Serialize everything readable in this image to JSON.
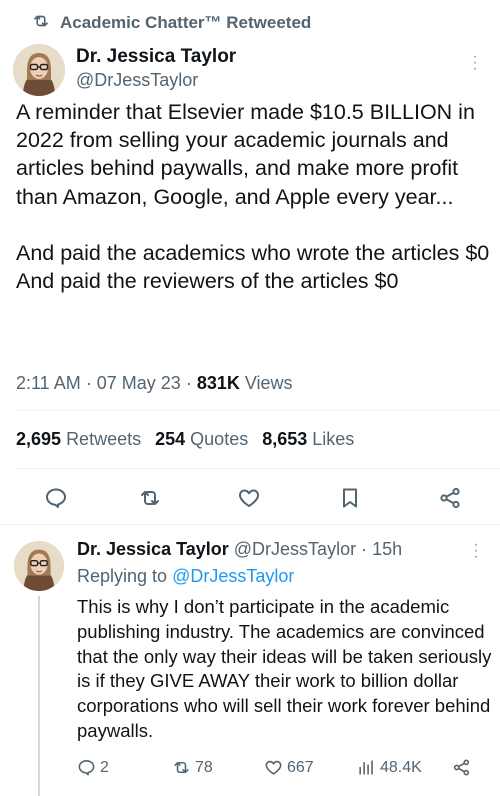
{
  "retweet_banner": {
    "text": "Academic Chatter™ Retweeted"
  },
  "main_tweet": {
    "author_name": "Dr. Jessica Taylor",
    "author_handle": "@DrJessTaylor",
    "text": "A reminder that Elsevier made $10.5 BILLION in 2022 from selling your academic journals and articles behind paywalls, and make more profit than Amazon, Google, and Apple every year...\n\nAnd paid the academics who wrote the articles $0\nAnd paid the reviewers of the articles $0",
    "time": "2:11 AM",
    "date": "07 May 23",
    "views_count": "831K",
    "views_label": "Views",
    "retweets_count": "2,695",
    "retweets_label": "Retweets",
    "quotes_count": "254",
    "quotes_label": "Quotes",
    "likes_count": "8,653",
    "likes_label": "Likes"
  },
  "reply": {
    "author_name": "Dr. Jessica Taylor",
    "author_handle": "@DrJessTaylor",
    "age": "15h",
    "replying_prefix": "Replying to",
    "replying_to": "@DrJessTaylor",
    "text": "This is why I don’t participate in the academic publishing industry. The academics are convinced that the only way their ideas will be taken seriously is if they GIVE AWAY their work to billion dollar corporations who will sell their work forever behind paywalls.",
    "reply_count": "2",
    "retweet_count": "78",
    "like_count": "667",
    "view_count": "48.4K"
  },
  "colors": {
    "text": "#0f1419",
    "secondary": "#536471",
    "link": "#1d9bf0",
    "divider": "#eff3f4"
  },
  "icons": [
    "retweet-icon",
    "more-icon",
    "reply-icon",
    "like-icon",
    "bookmark-icon",
    "share-icon",
    "views-icon"
  ]
}
